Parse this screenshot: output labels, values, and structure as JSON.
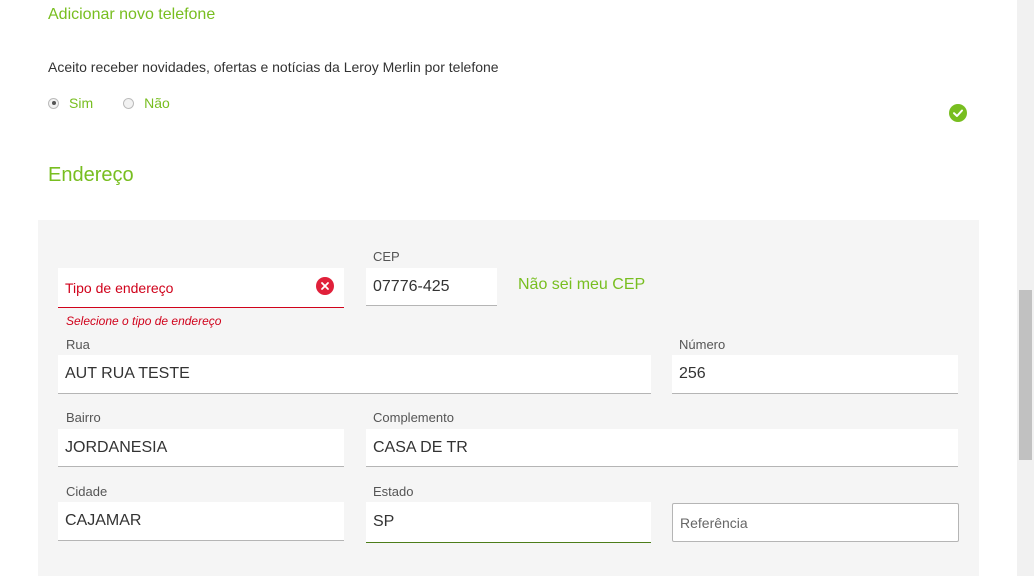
{
  "phone": {
    "add_label": "Adicionar novo telefone",
    "accept_text": "Aceito receber novidades, ofertas e notícias da Leroy Merlin por telefone",
    "options": [
      "Sim",
      "Não"
    ],
    "selected": "Sim"
  },
  "address": {
    "title": "Endereço",
    "tipo": {
      "placeholder": "Tipo de endereço",
      "error": "Selecione o tipo de endereço"
    },
    "cep": {
      "label": "CEP",
      "value": "07776-425",
      "link": "Não sei meu CEP"
    },
    "rua": {
      "label": "Rua",
      "value": "AUT RUA TESTE"
    },
    "numero": {
      "label": "Número",
      "value": "256"
    },
    "bairro": {
      "label": "Bairro",
      "value": "JORDANESIA"
    },
    "complemento": {
      "label": "Complemento",
      "value": "CASA DE TR"
    },
    "cidade": {
      "label": "Cidade",
      "value": "CAJAMAR"
    },
    "estado": {
      "label": "Estado",
      "value": "SP"
    },
    "referencia": {
      "placeholder": "Referência"
    }
  },
  "colors": {
    "brand_green": "#78be20",
    "error_red": "#d0021b"
  }
}
